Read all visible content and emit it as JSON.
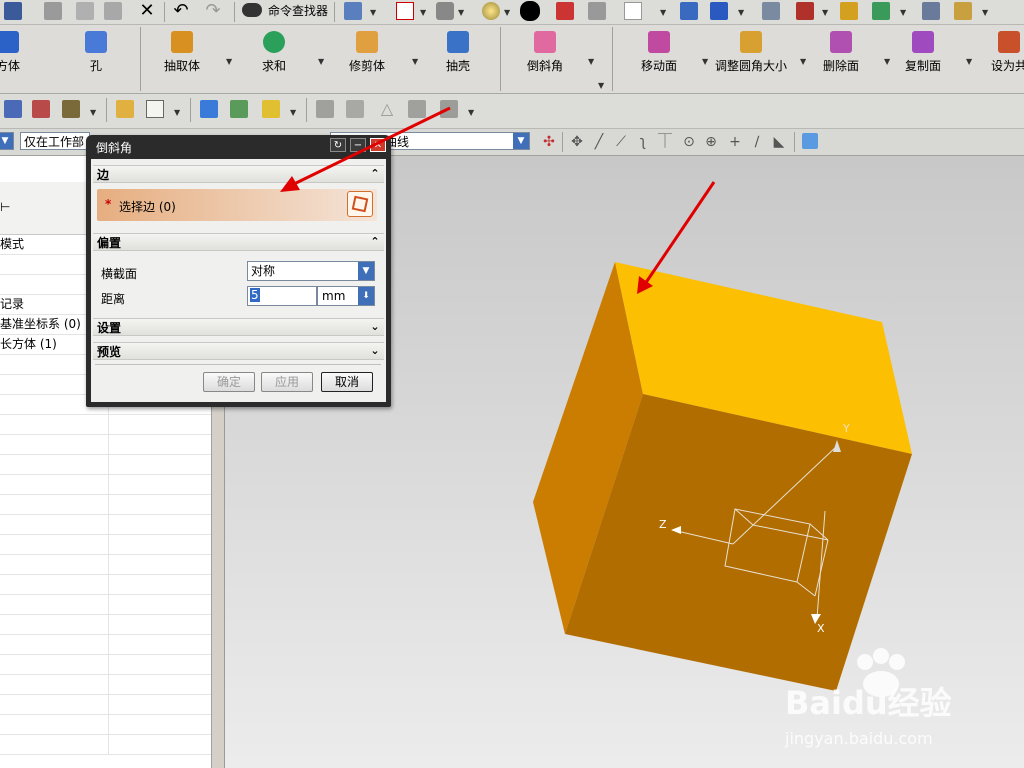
{
  "toolbar_top": {
    "command_finder_label": "命令查找器"
  },
  "feature_toolbar": {
    "items": [
      {
        "label": "方体"
      },
      {
        "label": "孔"
      },
      {
        "label": "抽取体"
      },
      {
        "label": "求和"
      },
      {
        "label": "修剪体"
      },
      {
        "label": "抽壳"
      },
      {
        "label": "倒斜角"
      },
      {
        "label": "移动面"
      },
      {
        "label": "调整圆角大小"
      },
      {
        "label": "删除面"
      },
      {
        "label": "复制面"
      },
      {
        "label": "设为共"
      }
    ]
  },
  "selection_bar": {
    "filter_value": "仅在工作部",
    "curve_rule_value": "相切曲线"
  },
  "part_navigator": {
    "rows": [
      "模式",
      "",
      "",
      "记录",
      "基准坐标系 (0)",
      "长方体 (1)"
    ]
  },
  "chamfer_dialog": {
    "title": "倒斜角",
    "section_edge": "边",
    "select_edge_prompt": "选择边 (0)",
    "section_offset": "偏置",
    "cross_section_label": "横截面",
    "cross_section_value": "对称",
    "distance_label": "距离",
    "distance_value": "5",
    "distance_unit": "mm",
    "section_settings": "设置",
    "section_preview": "预览",
    "ok_button": "确定",
    "apply_button": "应用",
    "cancel_button": "取消"
  },
  "viewport": {
    "axis_labels": {
      "y": "Y",
      "z": "Z",
      "x": "X"
    }
  },
  "watermark": {
    "text": "Baidu经验",
    "url": "jingyan.baidu.com"
  },
  "colors": {
    "cube_top": "#fcbf02",
    "cube_front": "#b16d00",
    "cube_left": "#ca7d00",
    "annotation_arrow": "#e00000",
    "required_field_bg": "#e6ae80"
  }
}
